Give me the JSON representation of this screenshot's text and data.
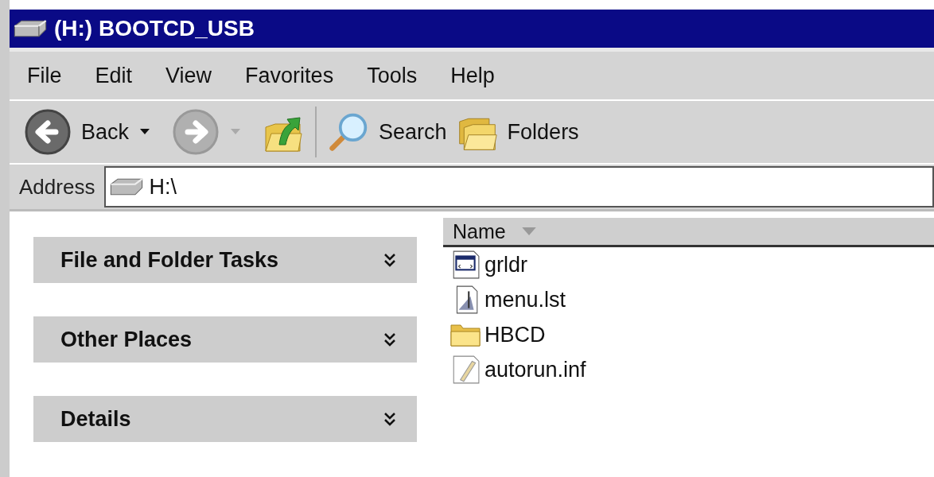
{
  "window": {
    "title": "(H:) BOOTCD_USB"
  },
  "menu": [
    "File",
    "Edit",
    "View",
    "Favorites",
    "Tools",
    "Help"
  ],
  "toolbar": [
    {
      "kind": "back",
      "label": "Back",
      "disabled": false
    },
    {
      "kind": "forward",
      "disabled": true
    },
    {
      "kind": "up",
      "disabled": false
    },
    {
      "kind": "search",
      "label": "Search",
      "disabled": false
    },
    {
      "kind": "folders",
      "label": "Folders",
      "disabled": false
    }
  ],
  "address": {
    "label": "Address",
    "value": "H:\\"
  },
  "task_panels": [
    {
      "title": "File and Folder Tasks",
      "expanded": false
    },
    {
      "title": "Other Places",
      "expanded": false
    },
    {
      "title": "Details",
      "expanded": false
    }
  ],
  "file_list": {
    "columns": [
      "Name"
    ],
    "items": [
      {
        "kind": "system",
        "name": "grldr"
      },
      {
        "kind": "text",
        "name": "menu.lst"
      },
      {
        "kind": "folder",
        "name": "HBCD"
      },
      {
        "kind": "settings",
        "name": "autorun.inf"
      }
    ]
  }
}
